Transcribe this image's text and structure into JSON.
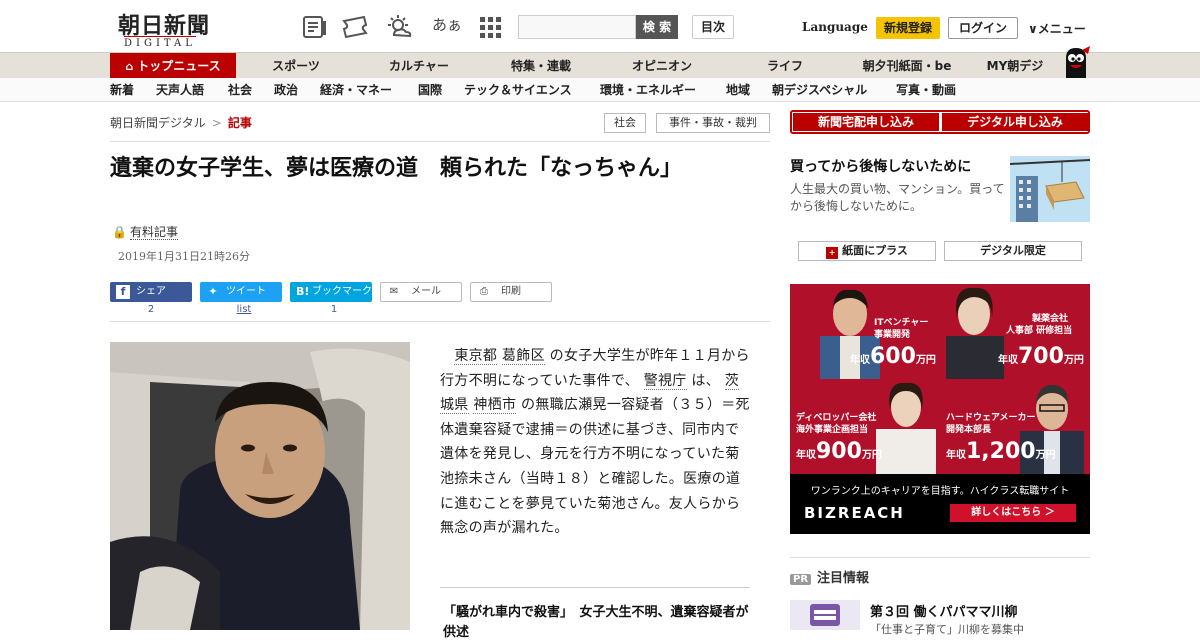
{
  "header": {
    "logo_jp": "朝日新聞",
    "logo_en": "DIGITAL",
    "kana_icon_text": "あぁ",
    "search_button": "検 索",
    "toc_button": "目次",
    "language": "Language",
    "signup": "新規登録",
    "login": "ログイン",
    "menu": "メニュー"
  },
  "nav_main": [
    "トップニュース",
    "スポーツ",
    "カルチャー",
    "特集・連載",
    "オピニオン",
    "ライフ",
    "朝夕刊紙面・be",
    "MY朝デジ"
  ],
  "nav_sub": [
    "新着",
    "天声人語",
    "社会",
    "政治",
    "経済・マネー",
    "国際",
    "テック＆サイエンス",
    "環境・エネルギー",
    "地域",
    "朝デジスペシャル",
    "写真・動画"
  ],
  "breadcrumb": {
    "home": "朝日新聞デジタル",
    "separator": ">",
    "current": "記事"
  },
  "tags": [
    "社会",
    "事件・事故・裁判"
  ],
  "article": {
    "headline": "遺棄の女子学生、夢は医療の道　頼られた「なっちゃん」",
    "paid_label": "有料記事",
    "date": "2019年1月31日21時26分",
    "body": {
      "p1": "　",
      "l1": "東京都",
      "p2": " ",
      "l2": "葛飾区",
      "p3": " の女子大学生が昨年１１月から行方不明になっていた事件で、 ",
      "l3": "警視庁",
      "p4": " は、 ",
      "l4": "茨城県",
      "p5": " ",
      "l5": "神栖市",
      "p6": " の無職広瀬晃一容疑者（３５）＝死体遺棄容疑で逮捕＝の供述に基づき、同市内で遺体を発見し、身元を行方不明になっていた菊池捺未さん（当時１８）と確認した。医療の道に進むことを夢見ていた菊池さん。友人らから無念の声が漏れた。"
    },
    "related": "「騒がれ車内で殺害」　女子大生不明、遺棄容疑者が供述"
  },
  "share": {
    "facebook": {
      "label": "シェア",
      "count": "2"
    },
    "twitter": {
      "label": "ツイート",
      "count": "list"
    },
    "hatena": {
      "label": "ブックマーク",
      "count": "1"
    },
    "mail": {
      "label": "メール"
    },
    "print": {
      "label": "印刷"
    }
  },
  "sidebar": {
    "subscribe": [
      "新聞宅配申し込み",
      "デジタル申し込み"
    ],
    "promo": {
      "title": "買ってから後悔しないために",
      "desc": "人生最大の買い物、マンション。買ってから後悔しないために。"
    },
    "pills": [
      "紙面にプラス",
      "デジタル限定"
    ],
    "ad": {
      "cells": [
        {
          "role1": "ITベンチャー",
          "role2": "事業開発",
          "prefix": "年収",
          "amount": "600",
          "unit": "万円"
        },
        {
          "role1": "製薬会社",
          "role2": "人事部 研修担当",
          "prefix": "年収",
          "amount": "700",
          "unit": "万円"
        },
        {
          "role1": "ディベロッパー会社",
          "role2": "海外事業企画担当",
          "prefix": "年収",
          "amount": "900",
          "unit": "万円"
        },
        {
          "role1": "ハードウェアメーカー",
          "role2": "開発本部長",
          "prefix": "年収",
          "amount": "1,200",
          "unit": "万円"
        }
      ],
      "tagline": "ワンランク上のキャリアを目指す。ハイクラス転職サイト",
      "brand": "BIZREACH",
      "cta": "詳しくはこちら ＞"
    },
    "featured": {
      "pr": "PR",
      "heading": "注目情報",
      "title": "第３回 働くパパママ川柳",
      "sub": "「仕事と子育て」川柳を募集中"
    }
  },
  "colors": {
    "brand_red": "#b00",
    "signup_yellow": "#f5c400",
    "facebook": "#3b5998",
    "twitter": "#1da1f2",
    "hatena": "#00a4de",
    "ad_red": "#b1102b"
  }
}
